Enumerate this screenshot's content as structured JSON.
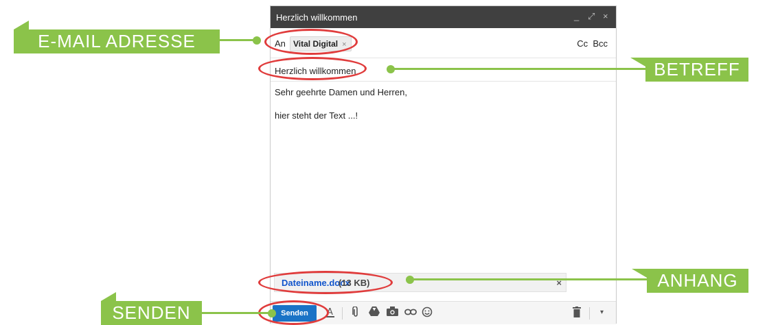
{
  "window": {
    "title": "Herzlich willkommen",
    "controls": [
      "_",
      "⤢",
      "×"
    ]
  },
  "to": {
    "label": "An",
    "recipient": "Vital Digital",
    "remove": "×",
    "cc_bcc": "Cc  Bcc"
  },
  "subject": "Herzlich willkommen",
  "body": {
    "line1": "Sehr geehrte Damen und Herren,",
    "line2": "hier steht der Text ...!"
  },
  "attachment": {
    "name": "Dateiname.docx",
    "size": "(13 KB)",
    "remove": "×"
  },
  "toolbar": {
    "send": "Senden",
    "icons": [
      "format-icon",
      "paperclip-icon",
      "drive-icon",
      "camera-icon",
      "link-icon",
      "emoji-icon",
      "trash-icon",
      "more-options-icon"
    ]
  },
  "callouts": {
    "email": "E-MAIL ADRESSE",
    "subject": "BETREFF",
    "attachment": "ANHANG",
    "send": "SENDEN"
  },
  "colors": {
    "callout": "#8bc34a",
    "highlight": "#e03c3c",
    "send_button": "#1a73c6",
    "titlebar": "#404040"
  }
}
